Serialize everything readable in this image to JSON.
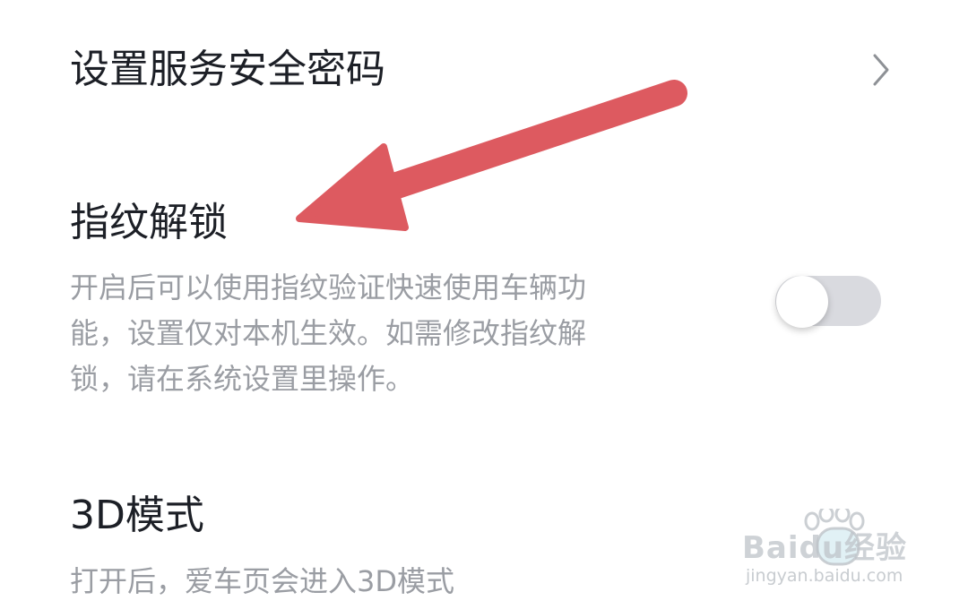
{
  "settings": {
    "service_password": {
      "title": "设置服务安全密码",
      "chevron_icon": "chevron-right-icon"
    },
    "fingerprint": {
      "title": "指纹解锁",
      "description_lines": [
        "开启后可以使用指纹验证快速使用车辆功",
        "能，设置仅对本机生效。如需修改指纹解",
        "锁，请在系统设置里操作。"
      ],
      "toggle_on": false
    },
    "mode_3d": {
      "title": "3D模式",
      "description": "打开后，爱车页会进入3D模式"
    }
  },
  "annotation": {
    "arrow_color": "#dd5a60"
  },
  "watermark": {
    "brand": "Baidu经验",
    "site": "jingyan.baidu.com"
  },
  "colors": {
    "title": "#1c1f26",
    "description": "#9a9da3",
    "toggle_track_off": "#d9dadf",
    "background": "#ffffff"
  }
}
